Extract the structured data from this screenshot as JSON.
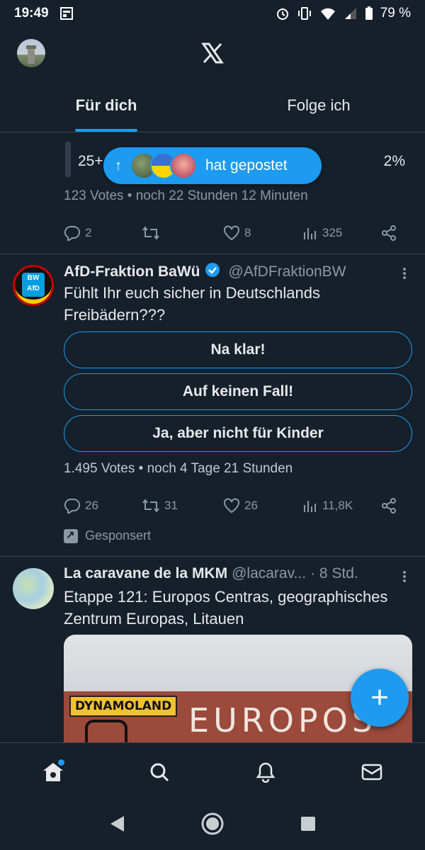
{
  "status_bar": {
    "time": "19:49",
    "battery": "79 %",
    "icons": [
      "alarm-icon",
      "vibrate-icon",
      "wifi-icon",
      "signal-icon",
      "battery-icon"
    ]
  },
  "header": {
    "logo": "X"
  },
  "tabs": [
    {
      "label": "Für dich",
      "active": true
    },
    {
      "label": "Folge ich",
      "active": false
    }
  ],
  "new_posts_pill": {
    "label": "hat gepostet"
  },
  "poll1": {
    "partial_option_label": "25+",
    "partial_option_percent": "2%",
    "meta": "123 Votes • noch 22 Stunden 12 Minuten",
    "actions": {
      "replies": "2",
      "reposts": "",
      "likes": "8",
      "views": "325"
    }
  },
  "tweet2": {
    "name": "AfD-Fraktion BaWü",
    "handle": "@AfDFraktionBW",
    "text": "Fühlt Ihr euch sicher in Deutschlands Freibädern???",
    "avatar_text": {
      "top": "BW",
      "bottom": "AfD"
    },
    "poll_options": [
      "Na klar!",
      "Auf keinen Fall!",
      "Ja, aber nicht für Kinder"
    ],
    "meta": "1.495 Votes • noch 4 Tage 21 Stunden",
    "actions": {
      "replies": "26",
      "reposts": "31",
      "likes": "26",
      "views": "11,8K"
    },
    "sponsored": "Gesponsert"
  },
  "tweet3": {
    "name": "La caravane de la MKM",
    "handle": "@lacarav...",
    "time": "· 8 Std.",
    "text": "Etappe 121: Europos Centras, geographisches Zentrum Europas, Litauen",
    "image_signs": {
      "left": "DYNAMOLAND",
      "wall": "EUROPOS"
    }
  },
  "colors": {
    "background": "#15202b",
    "accent": "#1d9bf0",
    "muted": "#8b98a5",
    "divider": "#38444d"
  }
}
